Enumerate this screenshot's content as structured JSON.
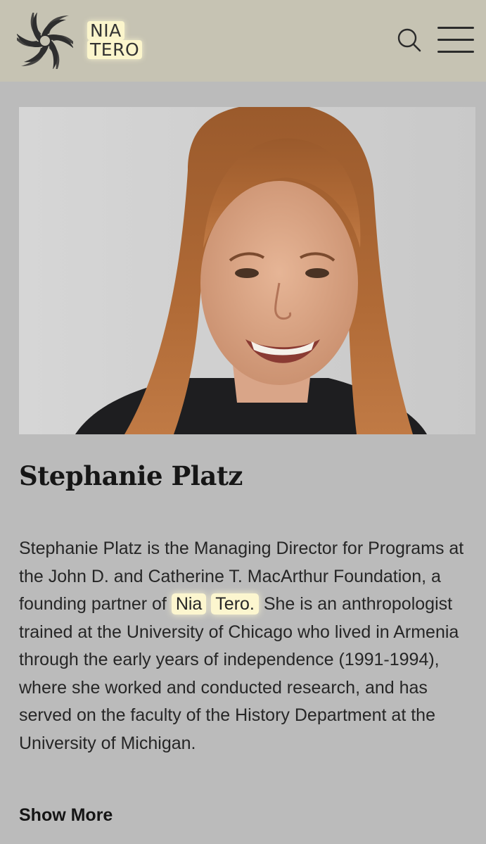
{
  "header": {
    "logo_line1": "NIA",
    "logo_line2": "TERO",
    "icons": [
      "nia-tero-logo-icon",
      "search-icon",
      "menu-icon"
    ]
  },
  "profile": {
    "name": "Stephanie Platz",
    "bio_part1": "Stephanie Platz is the Managing Director for Programs at the John D. and Catherine T. MacArthur Foundation, a founding partner of ",
    "bio_highlight1": "Nia",
    "bio_space": " ",
    "bio_highlight2": "Tero.",
    "bio_part2": " She is an anthropologist trained at the University of Chicago who lived in Armenia through the early years of independence (1991-1994), where she worked and conducted research, and has served on the faculty of the History Department at the University of Michigan.",
    "show_more_label": "Show More"
  },
  "colors": {
    "header_bg": "#c6c3b3",
    "page_bg": "#bbbbbb",
    "highlight": "#fcf6cf"
  }
}
